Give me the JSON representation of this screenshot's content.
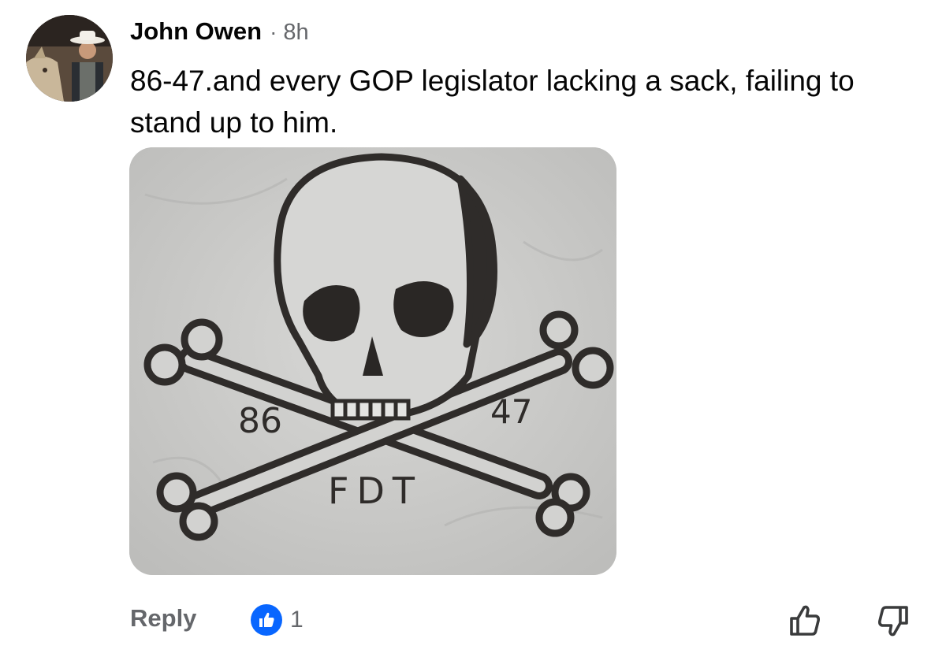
{
  "comment": {
    "author": "John Owen",
    "separator": "·",
    "time": "8h",
    "text": "86-47.and every GOP legislator lacking a sack, failing to stand up to him.",
    "avatar_icon": "avatar-cowboy-with-horse",
    "image": {
      "left_number": "86",
      "right_number": "47",
      "bottom_text": "FDT",
      "icon": "skull-and-crossbones"
    }
  },
  "footer": {
    "reply_label": "Reply",
    "reaction_icon": "like-icon",
    "reaction_count": "1",
    "upvote_icon": "thumbs-up-outline-icon",
    "downvote_icon": "thumbs-down-outline-icon"
  },
  "colors": {
    "text": "#050505",
    "secondary": "#65676b",
    "like_blue": "#0866ff",
    "image_bg": "#c9c9c7"
  }
}
